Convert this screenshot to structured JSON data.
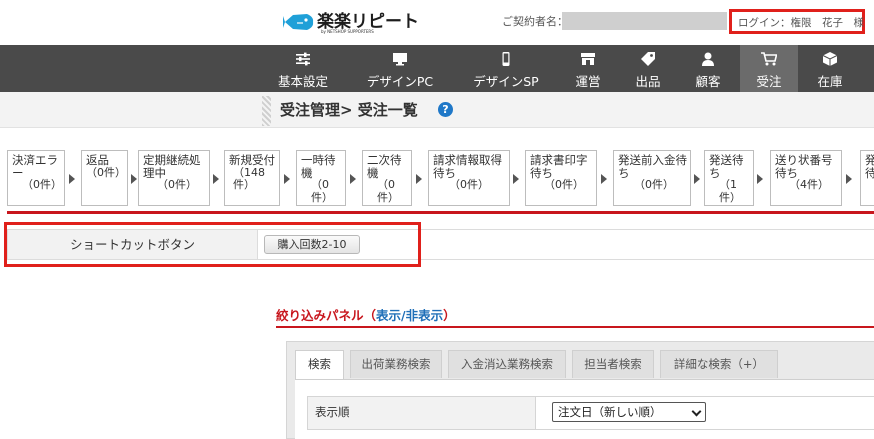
{
  "header": {
    "logo_text": "楽楽リピート",
    "logo_sub": "by NETSHOP SUPPORTERS",
    "contractor_label": "ご契約者名：",
    "login_text": "ログイン：権限　花子　様"
  },
  "nav": {
    "items": [
      {
        "label": "基本設定",
        "icon": "sliders-icon"
      },
      {
        "label": "デザインPC",
        "icon": "monitor-icon"
      },
      {
        "label": "デザインSP",
        "icon": "smartphone-icon"
      },
      {
        "label": "運営",
        "icon": "storefront-icon"
      },
      {
        "label": "出品",
        "icon": "tag-icon"
      },
      {
        "label": "顧客",
        "icon": "person-icon"
      },
      {
        "label": "受注",
        "icon": "cart-icon",
        "active": true
      },
      {
        "label": "在庫",
        "icon": "box-icon"
      }
    ]
  },
  "page": {
    "title": "受注管理> 受注一覧",
    "help": "?"
  },
  "flow": {
    "statuses": [
      {
        "label": "決済エラー",
        "count": "（0件）"
      },
      {
        "label": "返品",
        "count": "（0件）"
      },
      {
        "label": "定期継続処理中",
        "count": "（0件）"
      },
      {
        "label": "新規受付",
        "count": "（148件）"
      },
      {
        "label": "一時待機",
        "count": "（0件）"
      },
      {
        "label": "二次待機",
        "count": "（0件）"
      },
      {
        "label": "請求情報取得待ち",
        "count": "（0件）"
      },
      {
        "label": "請求書印字待ち",
        "count": "（0件）"
      },
      {
        "label": "発送前入金待ち",
        "count": "（0件）"
      },
      {
        "label": "発送待ち",
        "count": "（1件）"
      },
      {
        "label": "送り状番号待ち",
        "count": "（4件）"
      },
      {
        "label": "発送待",
        "count": ""
      }
    ]
  },
  "shortcut": {
    "label": "ショートカットボタン",
    "button": "購入回数2-10"
  },
  "filter": {
    "title_prefix": "絞り込みパネル（",
    "toggle": "表示/非表示",
    "title_suffix": "）",
    "tabs": [
      "検索",
      "出荷業務検索",
      "入金消込業務検索",
      "担当者検索",
      "詳細な検索（+）"
    ],
    "sort_label": "表示順",
    "sort_value": "注文日（新しい順）"
  },
  "colors": {
    "accent_red": "#c8161d",
    "nav_bg": "#4a4a4a",
    "link_blue": "#1f6fb8"
  }
}
